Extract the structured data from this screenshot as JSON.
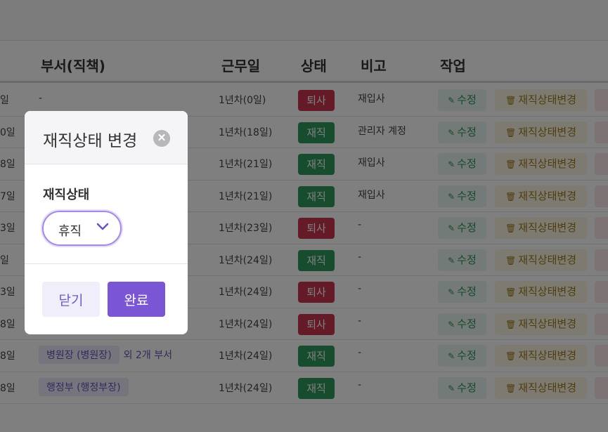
{
  "table": {
    "headers": {
      "dept": "부서(직책)",
      "days": "근무일",
      "status": "상태",
      "note": "비고",
      "action": "작업"
    },
    "edit_label": "수정",
    "change_label": "재직상태변경",
    "status_colors": {
      "재직": "#2e9a5c",
      "퇴사": "#c9364e"
    },
    "rows": [
      {
        "date": "일",
        "dept": "-",
        "days": "1년차(0일)",
        "status": "퇴사",
        "note": "재입사"
      },
      {
        "date": "0일",
        "dept": "",
        "days": "1년차(18일)",
        "status": "재직",
        "note": "관리자 계정"
      },
      {
        "date": "8일",
        "dept": "",
        "days": "1년차(21일)",
        "status": "재직",
        "note": "재입사"
      },
      {
        "date": "7일",
        "dept": "",
        "days": "1년차(21일)",
        "status": "재직",
        "note": "재입사"
      },
      {
        "date": "3일",
        "dept": "",
        "days": "1년차(23일)",
        "status": "퇴사",
        "note": "-"
      },
      {
        "date": "일",
        "dept": "",
        "days": "1년차(24일)",
        "status": "재직",
        "note": "-"
      },
      {
        "date": "3일",
        "dept": "",
        "days": "1년차(24일)",
        "status": "퇴사",
        "note": "-"
      },
      {
        "date": "8일",
        "dept": "",
        "days": "1년차(24일)",
        "status": "퇴사",
        "note": "-"
      },
      {
        "date": "8일",
        "dept_chip": "병원장 (병원장)",
        "dept_more": "외 2개 부서",
        "days": "1년차(24일)",
        "status": "재직",
        "note": "-"
      },
      {
        "date": "8일",
        "dept_chip": "행정부 (행정부장)",
        "days": "1년차(24일)",
        "status": "재직",
        "note": "-"
      }
    ]
  },
  "modal": {
    "title": "재직상태 변경",
    "close_icon": "x-circle-icon",
    "field_label": "재직상태",
    "select_value": "휴직",
    "buttons": {
      "close": "닫기",
      "done": "완료"
    },
    "accent_color": "#7a55d4"
  }
}
